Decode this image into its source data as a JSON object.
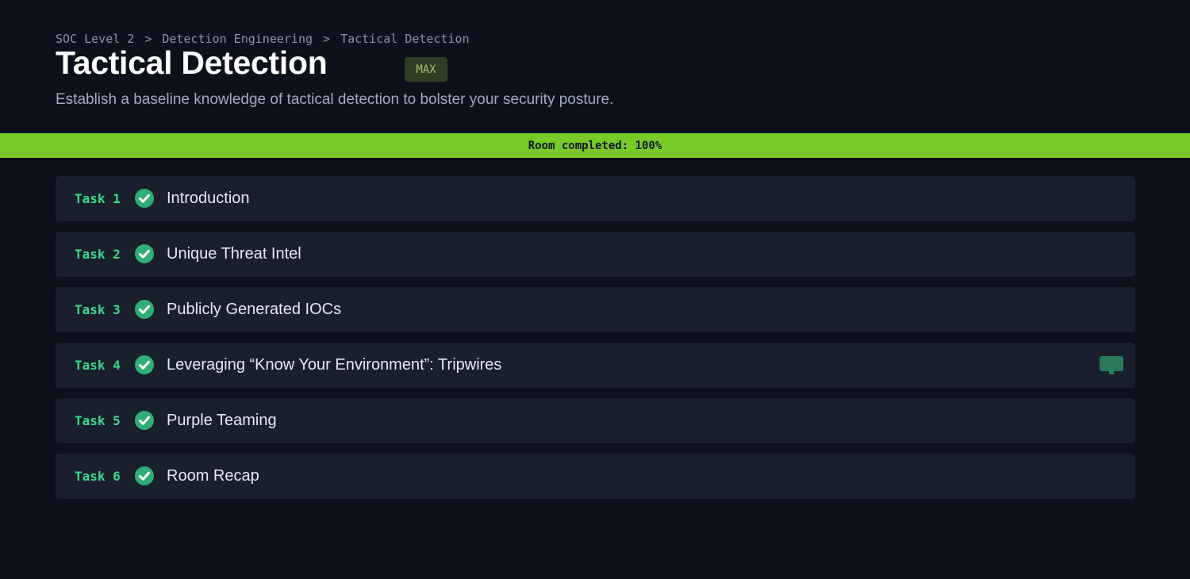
{
  "breadcrumb": {
    "items": [
      "SOC Level 2",
      "Detection Engineering",
      "Tactical Detection"
    ],
    "separator": ">"
  },
  "room": {
    "title": "Tactical Detection",
    "badge": "MAX",
    "subtitle": "Establish a baseline knowledge of tactical detection to bolster your security posture."
  },
  "progress": {
    "label": "Room completed: 100%",
    "percent": 100,
    "color": "#79c929"
  },
  "tasks": [
    {
      "number": "Task 1",
      "title": "Introduction",
      "completed": true,
      "icon": "check-circle-icon"
    },
    {
      "number": "Task 2",
      "title": "Unique Threat Intel",
      "completed": true,
      "icon": "check-circle-icon"
    },
    {
      "number": "Task 3",
      "title": "Publicly Generated IOCs",
      "completed": true,
      "icon": "check-circle-icon"
    },
    {
      "number": "Task 4",
      "title": "Leveraging “Know Your Environment”: Tripwires",
      "completed": true,
      "icon": "check-circle-icon",
      "extra_icon": "comment-icon"
    },
    {
      "number": "Task 5",
      "title": "Purple Teaming",
      "completed": true,
      "icon": "check-circle-icon"
    },
    {
      "number": "Task 6",
      "title": "Room Recap",
      "completed": true,
      "icon": "check-circle-icon"
    }
  ],
  "colors": {
    "background": "#0d111c",
    "task_background": "#1a1f2e",
    "task_number": "#3ddb8a",
    "check": "#2fae77",
    "badge_background": "#2f3d22",
    "badge_text": "#a3c26b"
  }
}
